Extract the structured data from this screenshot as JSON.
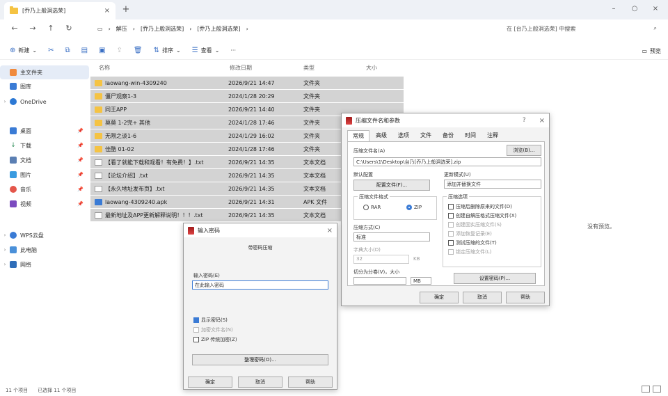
{
  "tab": {
    "title": "[乔乃上般洞选荣]",
    "close": "×",
    "new": "+"
  },
  "window_controls": [
    "–",
    "○",
    "×"
  ],
  "nav": {
    "back": "←",
    "forward": "→",
    "up": "↑",
    "refresh": "↻",
    "crumbs": [
      "解压",
      "[乔乃上般洞选荣]",
      "[乔乃上般洞选荣]"
    ],
    "search_placeholder": "在 [台乃上般洞选荣] 中搜索"
  },
  "toolbar": {
    "new_label": "新建",
    "sort_label": "排序",
    "view_label": "查看",
    "more_label": "···",
    "details_label": "预览"
  },
  "sidebar": {
    "home": "主文件夹",
    "gallery": "图库",
    "onedrive": "OneDrive",
    "quick": [
      "桌面",
      "下载",
      "文档",
      "图片",
      "音乐",
      "视频"
    ],
    "wps": "WPS云盘",
    "pc": "此电脑",
    "network": "网络"
  },
  "columns": {
    "name": "名称",
    "date": "修改日期",
    "type": "类型",
    "size": "大小"
  },
  "files": [
    {
      "name": "laowang-win-4309240",
      "date": "2026/9/21 14:47",
      "type": "文件夹",
      "kind": "folder"
    },
    {
      "name": "僵尸观察1-3",
      "date": "2024/1/28 20:29",
      "type": "文件夹",
      "kind": "folder"
    },
    {
      "name": "同王APP",
      "date": "2026/9/21 14:40",
      "type": "文件夹",
      "kind": "folder"
    },
    {
      "name": "莫莫 1-2完+ 其他",
      "date": "2024/1/28 17:46",
      "type": "文件夹",
      "kind": "folder"
    },
    {
      "name": "无限之谈1-6",
      "date": "2024/1/29 16:02",
      "type": "文件夹",
      "kind": "folder"
    },
    {
      "name": "佳酷 01-02",
      "date": "2024/1/28 17:46",
      "type": "文件夹",
      "kind": "folder"
    },
    {
      "name": "【看了就能下载和观看！有免费！】.txt",
      "date": "2026/9/21 14:35",
      "type": "文本文档",
      "kind": "txt"
    },
    {
      "name": "【论坛介绍】.txt",
      "date": "2026/9/21 14:35",
      "type": "文本文档",
      "kind": "txt"
    },
    {
      "name": "【永久地址发布页】.txt",
      "date": "2026/9/21 14:35",
      "type": "文本文档",
      "kind": "txt"
    },
    {
      "name": "laowang-4309240.apk",
      "date": "2026/9/21 14:31",
      "type": "APK 文件",
      "kind": "apk"
    },
    {
      "name": "最新地址及APP更新解释说明！！！.txt",
      "date": "2026/9/21 14:35",
      "type": "文本文档",
      "kind": "txt"
    }
  ],
  "no_preview": "没有预览。",
  "status": {
    "count": "11 个项目",
    "selected": "已选择 11 个项目"
  },
  "rar_dialog": {
    "title": "压缩文件名和参数",
    "help": "?",
    "close": "×",
    "tabs": [
      "常规",
      "高级",
      "选项",
      "文件",
      "备份",
      "时间",
      "注释"
    ],
    "archive_name_label": "压缩文件名(A)",
    "browse_button": "浏览(B)...",
    "archive_name_value": "C:\\Users\\1\\Desktop\\台乃[乔乃上般洞选荣].zip",
    "profile_label": "默认配置",
    "profile_button": "配置文件(F)...",
    "update_label": "更新模式(U)",
    "update_value": "添加并替换文件",
    "format_label": "压缩文件格式",
    "format_rar": "RAR",
    "format_zip": "ZIP",
    "method_label": "压缩方式(C)",
    "method_value": "标准",
    "dict_label": "字典大小(D)",
    "dict_value": "32",
    "dict_unit": "KB",
    "split_label": "切分为分卷(V)，大小",
    "split_unit": "MB",
    "options_label": "压缩选项",
    "options": [
      {
        "label": "压缩后删除原来的文件(D)",
        "state": "off"
      },
      {
        "label": "创建自解压格式压缩文件(X)",
        "state": "off"
      },
      {
        "label": "创建固实压缩文件(S)",
        "state": "dim"
      },
      {
        "label": "添加恢复记录(E)",
        "state": "dim"
      },
      {
        "label": "测试压缩的文件(T)",
        "state": "off"
      },
      {
        "label": "锁定压缩文件(L)",
        "state": "dim"
      }
    ],
    "password_button": "设置密码(P)...",
    "ok": "确定",
    "cancel": "取消",
    "help_button": "帮助"
  },
  "pwd_dialog": {
    "title": "输入密码",
    "close": "×",
    "subtitle": "带密码压缩",
    "label": "输入密码(E)",
    "placeholder": "在此输入密码",
    "opts": [
      {
        "label": "显示密码(S)",
        "state": "on"
      },
      {
        "label": "加密文件名(N)",
        "state": "dim"
      },
      {
        "label": "ZIP 传统加密(Z)",
        "state": "off"
      }
    ],
    "manage_button": "整理密码(O)...",
    "ok": "确定",
    "cancel": "取消",
    "help_button": "帮助"
  },
  "colors": {
    "accent": "#3a7bd5",
    "folder": "#f5c343",
    "selection": "#d3d3d3"
  }
}
